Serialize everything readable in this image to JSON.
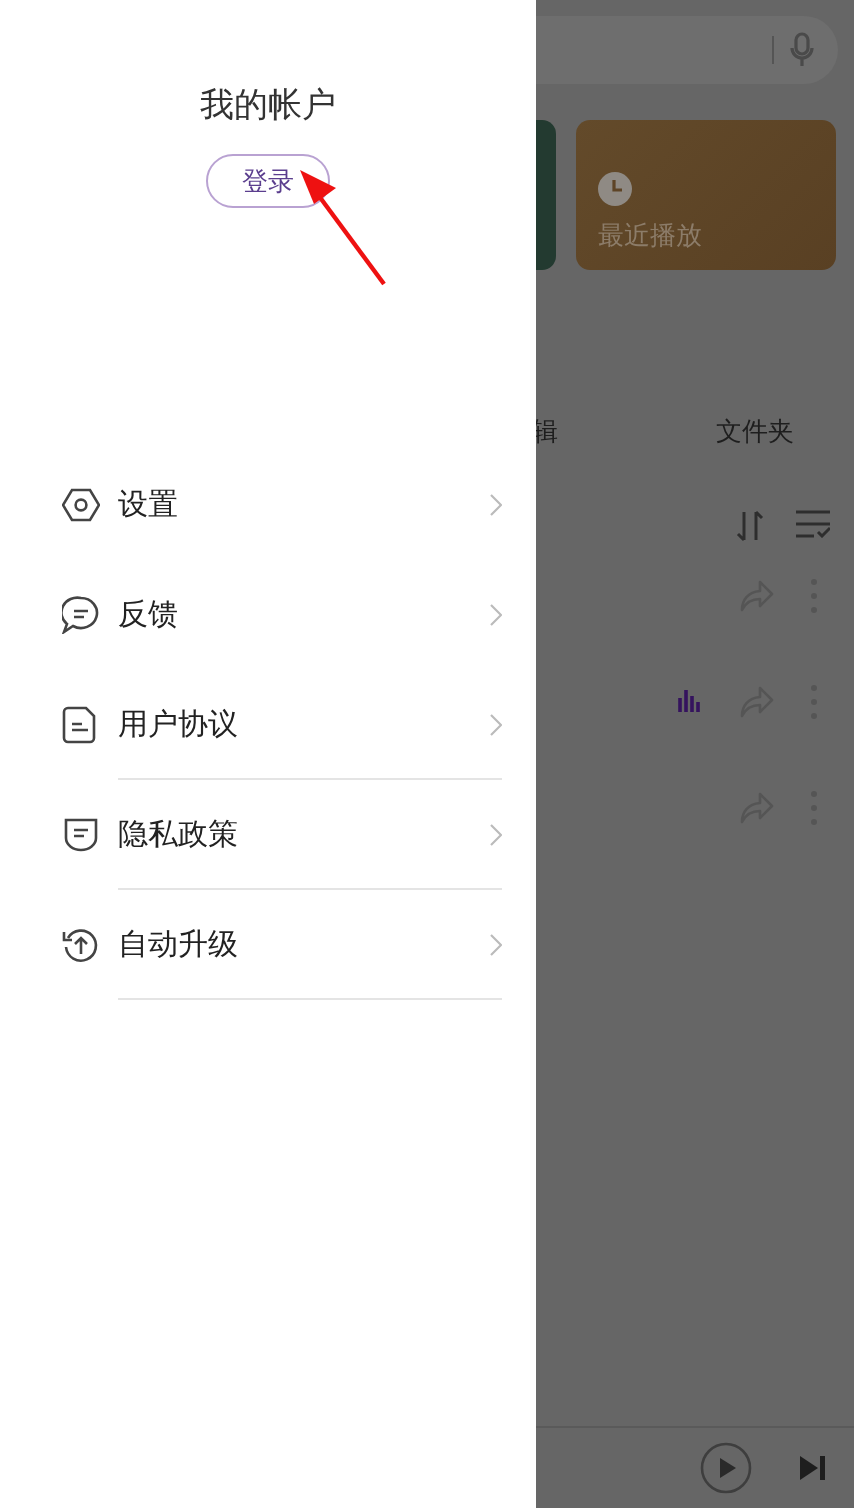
{
  "background": {
    "recent_card": {
      "label": "最近播放"
    },
    "tabs": [
      "辑",
      "文件夹"
    ],
    "songs": [
      {
        "playing": false
      },
      {
        "playing": true
      },
      {
        "playing": false
      }
    ]
  },
  "drawer": {
    "title": "我的帐户",
    "login_button": "登录",
    "menu": [
      {
        "label": "设置",
        "divider": false
      },
      {
        "label": "反馈",
        "divider": false
      },
      {
        "label": "用户协议",
        "divider": true
      },
      {
        "label": "隐私政策",
        "divider": true
      },
      {
        "label": "自动升级",
        "divider": true
      }
    ]
  }
}
